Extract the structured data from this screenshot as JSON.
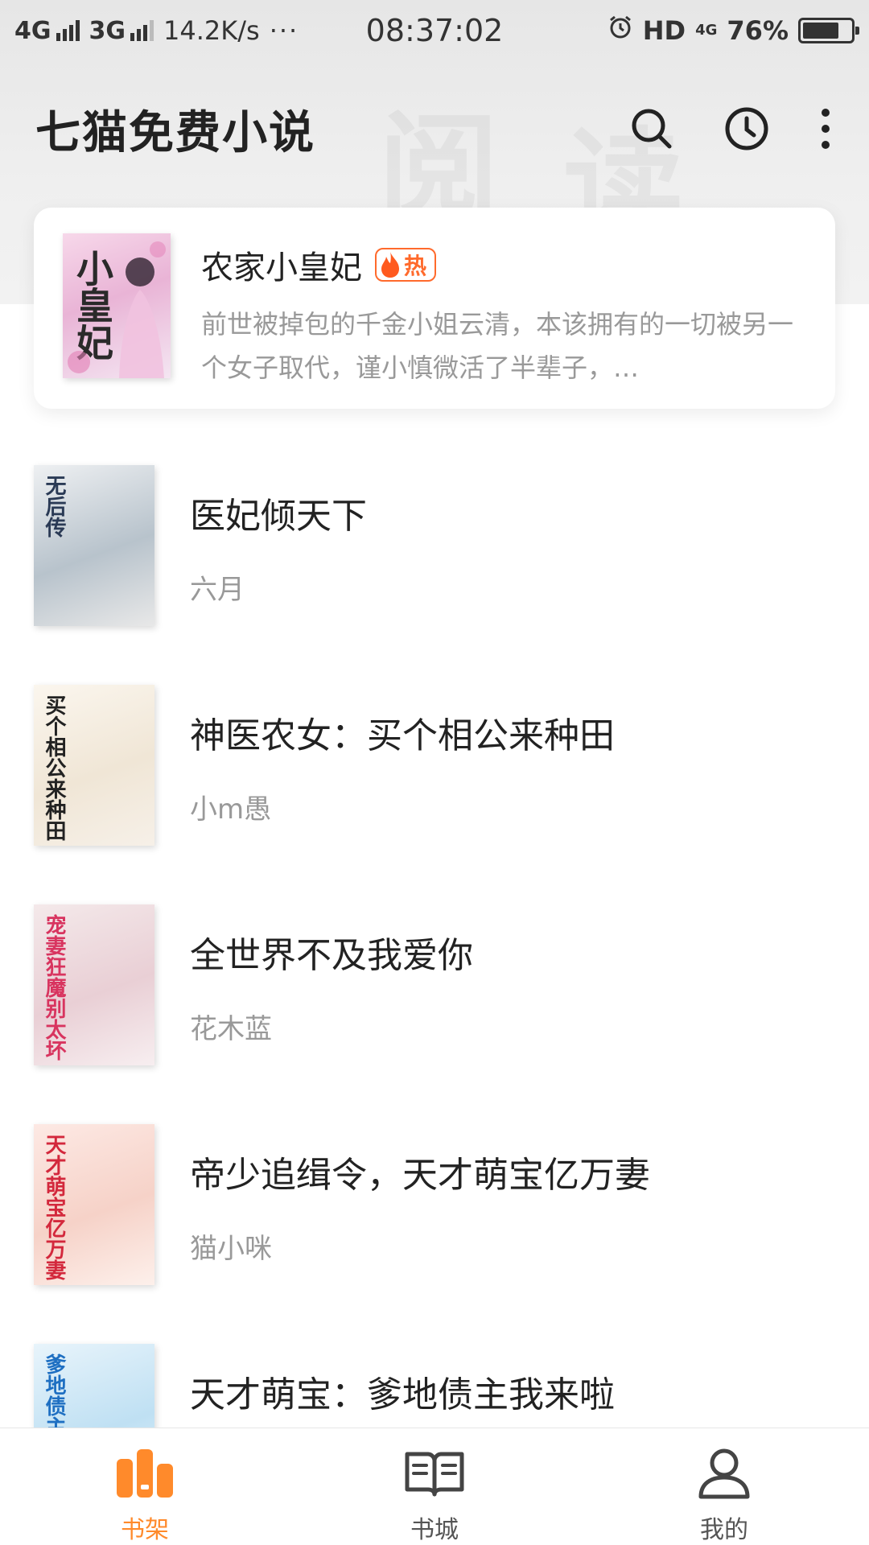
{
  "status_bar": {
    "network1": "4G",
    "network2": "3G",
    "speed": "14.2K/s",
    "dots": "···",
    "time": "08:37:02",
    "hd": "HD",
    "lte": "4G",
    "battery": "76%",
    "battery_level": 0.76
  },
  "header": {
    "title": "七猫免费小说",
    "deco_chars": [
      "阅",
      "读"
    ]
  },
  "recommend": {
    "title": "农家小皇妃",
    "badge": "热",
    "description": "前世被掉包的千金小姐云清，本该拥有的一切被另一个女子取代，谨小慎微活了半辈子，…",
    "cover_text": "小皇妃"
  },
  "books": [
    {
      "title": "医妃倾天下",
      "author": "六月",
      "cover_text": "无后传",
      "cover_colors": [
        "#eef0f2",
        "#b8c3cc",
        "#e8e8e8"
      ],
      "cover_ink": "#2a3a55"
    },
    {
      "title": "神医农女：买个相公来种田",
      "author": "小m愚",
      "cover_text": "买个相公来种田",
      "cover_colors": [
        "#fbf6ee",
        "#f0e6d6",
        "#f6f0e8"
      ],
      "cover_ink": "#222222"
    },
    {
      "title": "全世界不及我爱你",
      "author": "花木蓝",
      "cover_text": "宠妻狂魔别太坏",
      "cover_colors": [
        "#f4e9ea",
        "#e9cfd5",
        "#f7eef0"
      ],
      "cover_ink": "#d8345f"
    },
    {
      "title": "帝少追缉令，天才萌宝亿万妻",
      "author": "猫小咪",
      "cover_text": "天才萌宝亿万妻",
      "cover_colors": [
        "#fde9e4",
        "#f6d2c8",
        "#fdf0eb"
      ],
      "cover_ink": "#d3283c"
    },
    {
      "title": "天才萌宝：爹地债主我来啦",
      "author": "",
      "cover_text": "爹地债主我来啦",
      "cover_colors": [
        "#e8f4fb",
        "#bfe0f3",
        "#eaf6fc"
      ],
      "cover_ink": "#1e6fc2"
    }
  ],
  "nav": {
    "items": [
      {
        "label": "书架",
        "icon": "bookshelf-icon",
        "active": true
      },
      {
        "label": "书城",
        "icon": "book-open-icon",
        "active": false
      },
      {
        "label": "我的",
        "icon": "user-icon",
        "active": false
      }
    ]
  },
  "colors": {
    "accent": "#ff8a2b",
    "hot": "#ff6a2c",
    "title": "#222222",
    "subtitle": "#999999"
  }
}
